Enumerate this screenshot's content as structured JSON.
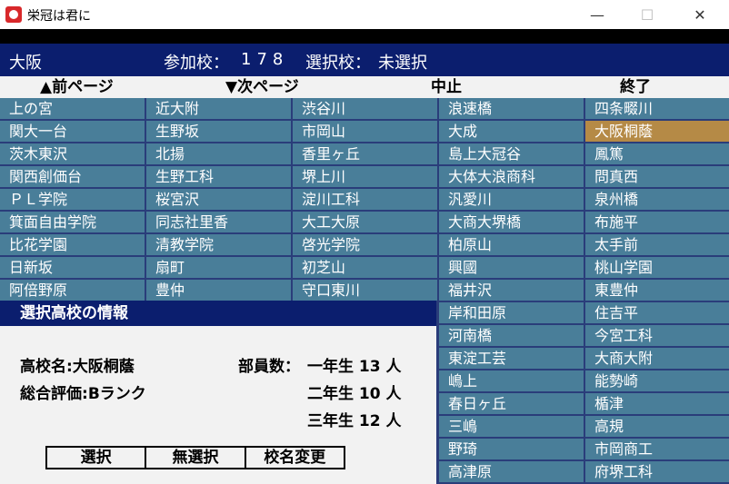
{
  "window": {
    "title": "栄冠は君に",
    "minimize_icon": "—",
    "maximize_icon": "☐",
    "close_icon": "✕"
  },
  "header": {
    "region": "大阪",
    "participants_label": "参加校：",
    "participants_value": "178",
    "selected_label": "選択校：",
    "selected_value": "未選択"
  },
  "nav": {
    "prev": "▲前ページ",
    "next": "▼次ページ",
    "stop": "中止",
    "end": "終了"
  },
  "schools": {
    "col1": [
      "上の宮",
      "関大一台",
      "茨木東沢",
      "関西創価台",
      "ＰＬ学院",
      "箕面自由学院",
      "比花学園",
      "日新坂",
      "阿倍野原"
    ],
    "col2": [
      "近大附",
      "生野坂",
      "北揚",
      "生野工科",
      "桜宮沢",
      "同志社里香",
      "清教学院",
      "扇町",
      "豊仲"
    ],
    "col3": [
      "渋谷川",
      "市岡山",
      "香里ヶ丘",
      "堺上川",
      "淀川工科",
      "大工大原",
      "啓光学院",
      "初芝山",
      "守口東川"
    ],
    "col4": [
      "浪速橋",
      "大成",
      "島上大冠谷",
      "大体大浪商科",
      "汎愛川",
      "大商大堺橋",
      "柏原山",
      "興國",
      "福井沢",
      "岸和田原",
      "河南橋",
      "東淀工芸",
      "嶋上",
      "春日ヶ丘",
      "三嶋",
      "野琦",
      "高津原"
    ],
    "col5": [
      "四条畷川",
      "大阪桐蔭",
      "鳳篤",
      "問真西",
      "泉州橋",
      "布施平",
      "太手前",
      "桃山学園",
      "東豊仲",
      "住吉平",
      "今宮工科",
      "大商大附",
      "能勢崎",
      "楯津",
      "高規",
      "市岡商工",
      "府堺工科"
    ]
  },
  "selected_school": "大阪桐蔭",
  "info": {
    "title": "選択高校の情報",
    "name_label": "高校名:",
    "name_value": "大阪桐蔭",
    "rating_label": "総合評価:",
    "rating_value": "Bランク",
    "members_label": "部員数：",
    "year1": "一年生 13 人",
    "year2": "二年生 10 人",
    "year3": "三年生 12 人",
    "buttons": {
      "select": "選択",
      "deselect": "無選択",
      "rename": "校名変更"
    }
  },
  "colors": {
    "header_bg": "#0b1e6e",
    "cell_bg": "#497e99",
    "selected_cell_bg": "#b58a46"
  }
}
